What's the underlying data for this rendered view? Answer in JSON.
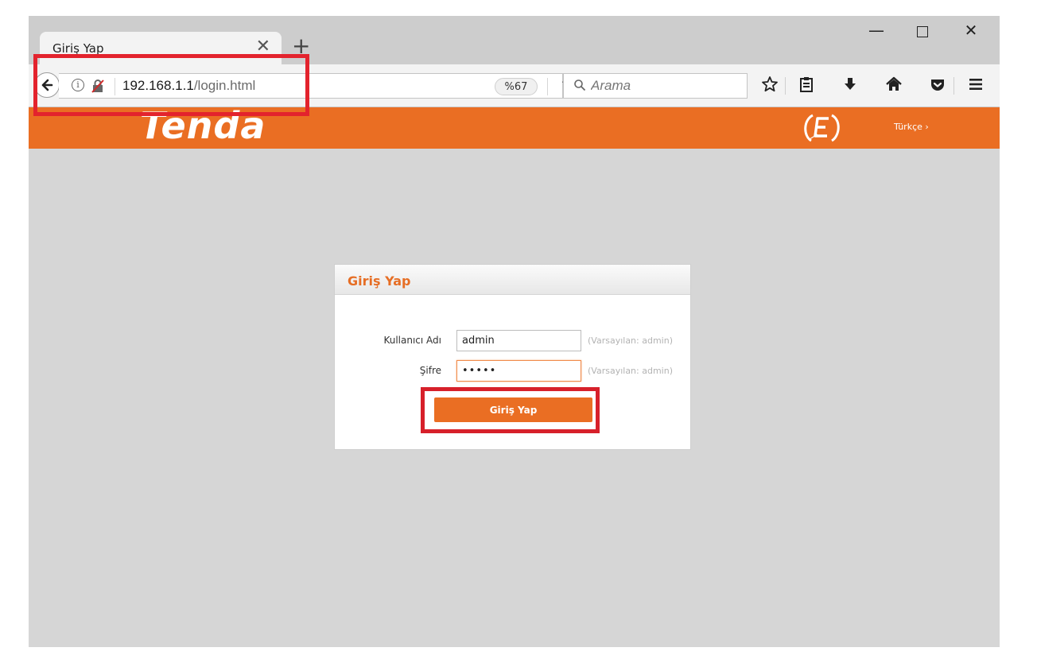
{
  "browser": {
    "tab_title": "Giriş Yap",
    "tab_close_glyph": "✕",
    "new_tab_glyph": "+",
    "url_host": "192.168.1.1",
    "url_path": "/login.html",
    "zoom": "%67",
    "search_placeholder": "Arama",
    "window_min_glyph": "—",
    "window_close_glyph": "✕",
    "reload_glyph": "↻"
  },
  "icons": {
    "back": "back-arrow-icon",
    "info": "info-icon",
    "connection": "insecure-lock-icon",
    "reload": "reload-icon",
    "search": "search-icon",
    "bookmark": "star-icon",
    "reader": "clipboard-icon",
    "download": "download-icon",
    "home": "home-icon",
    "pocket": "pocket-icon",
    "menu": "hamburger-menu-icon"
  },
  "header": {
    "brand": "Tenda",
    "language": "Türkçe ›"
  },
  "login": {
    "title": "Giriş Yap",
    "username_label": "Kullanıcı Adı",
    "username_value": "admin",
    "username_hint": "(Varsayılan: admin)",
    "password_label": "Şifre",
    "password_value": "admin",
    "password_hint": "(Varsayılan: admin)",
    "submit_label": "Giriş Yap"
  },
  "colors": {
    "brand_orange": "#ea6e23",
    "annotation_red": "#e3232d",
    "page_background": "#d6d6d6"
  }
}
